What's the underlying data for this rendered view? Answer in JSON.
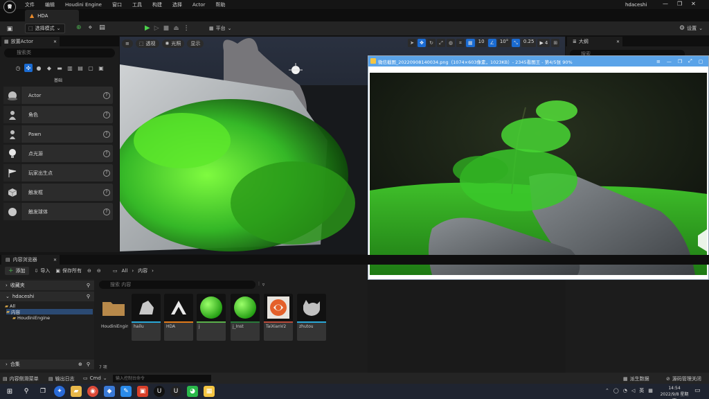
{
  "app": {
    "menu": [
      "文件",
      "编辑",
      "Houdini Engine",
      "窗口",
      "工具",
      "构建",
      "选择",
      "Actor",
      "帮助"
    ],
    "project_name": "hdaceshi",
    "window_controls": [
      "—",
      "❐",
      "✕"
    ],
    "doc_tab": "HDA"
  },
  "toolbar": {
    "mode_label": "选择模式",
    "platform_label": "平台",
    "settings_label": "设置"
  },
  "place_actors": {
    "tab_label": "放置Actor",
    "search_placeholder": "搜索类",
    "category_label": "基础",
    "items": [
      {
        "label": "Actor",
        "icon": "sphere-icon"
      },
      {
        "label": "角色",
        "icon": "character-icon"
      },
      {
        "label": "Pawn",
        "icon": "pawn-icon"
      },
      {
        "label": "点光源",
        "icon": "light-bulb-icon"
      },
      {
        "label": "玩家出生点",
        "icon": "flag-icon"
      },
      {
        "label": "触发框",
        "icon": "cube-icon"
      },
      {
        "label": "触发球体",
        "icon": "sphere-icon"
      }
    ]
  },
  "viewport": {
    "perspective_label": "透视",
    "lit_label": "光照",
    "show_label": "显示",
    "grid_snap": "10",
    "rotation_snap": "10°",
    "scale_snap": "0.25",
    "camera_speed": "4"
  },
  "outliner": {
    "tab_label": "大纲",
    "search_placeholder": "搜索"
  },
  "image_viewer": {
    "title": "微信截图_20220908140034.png（1074×603像素，1023KB）- 2345看图王 - 第4/5张 90%"
  },
  "content_browser": {
    "tab_label": "内容浏览器",
    "add_label": "添加",
    "import_label": "导入",
    "save_all_label": "保存所有",
    "path": [
      "All",
      "内容"
    ],
    "favorites_label": "收藏夹",
    "project_label": "hdaceshi",
    "tree": [
      "All",
      "内容",
      "HoudiniEngine"
    ],
    "collections_label": "合集",
    "search_placeholder": "搜索 内容",
    "assets": [
      {
        "name": "HoudiniEngine",
        "type": "folder"
      },
      {
        "name": "hailu",
        "type": "mesh"
      },
      {
        "name": "HDA",
        "type": "hda"
      },
      {
        "name": "j",
        "type": "material"
      },
      {
        "name": "j_Inst",
        "type": "material"
      },
      {
        "name": "TaiXianV2",
        "type": "texture"
      },
      {
        "name": "zhutou",
        "type": "mesh"
      }
    ],
    "item_count": "7 项"
  },
  "status_bar": {
    "content_drawer": "内容侧滑菜单",
    "output_log": "输出日志",
    "cmd_label": "Cmd",
    "cmd_placeholder": "输入控制台命令",
    "derived_data": "派生数据",
    "source_control": "源码管理关闭"
  },
  "taskbar": {
    "ime": "英",
    "time": "14:54",
    "date": "2022/9/8 星期四"
  }
}
